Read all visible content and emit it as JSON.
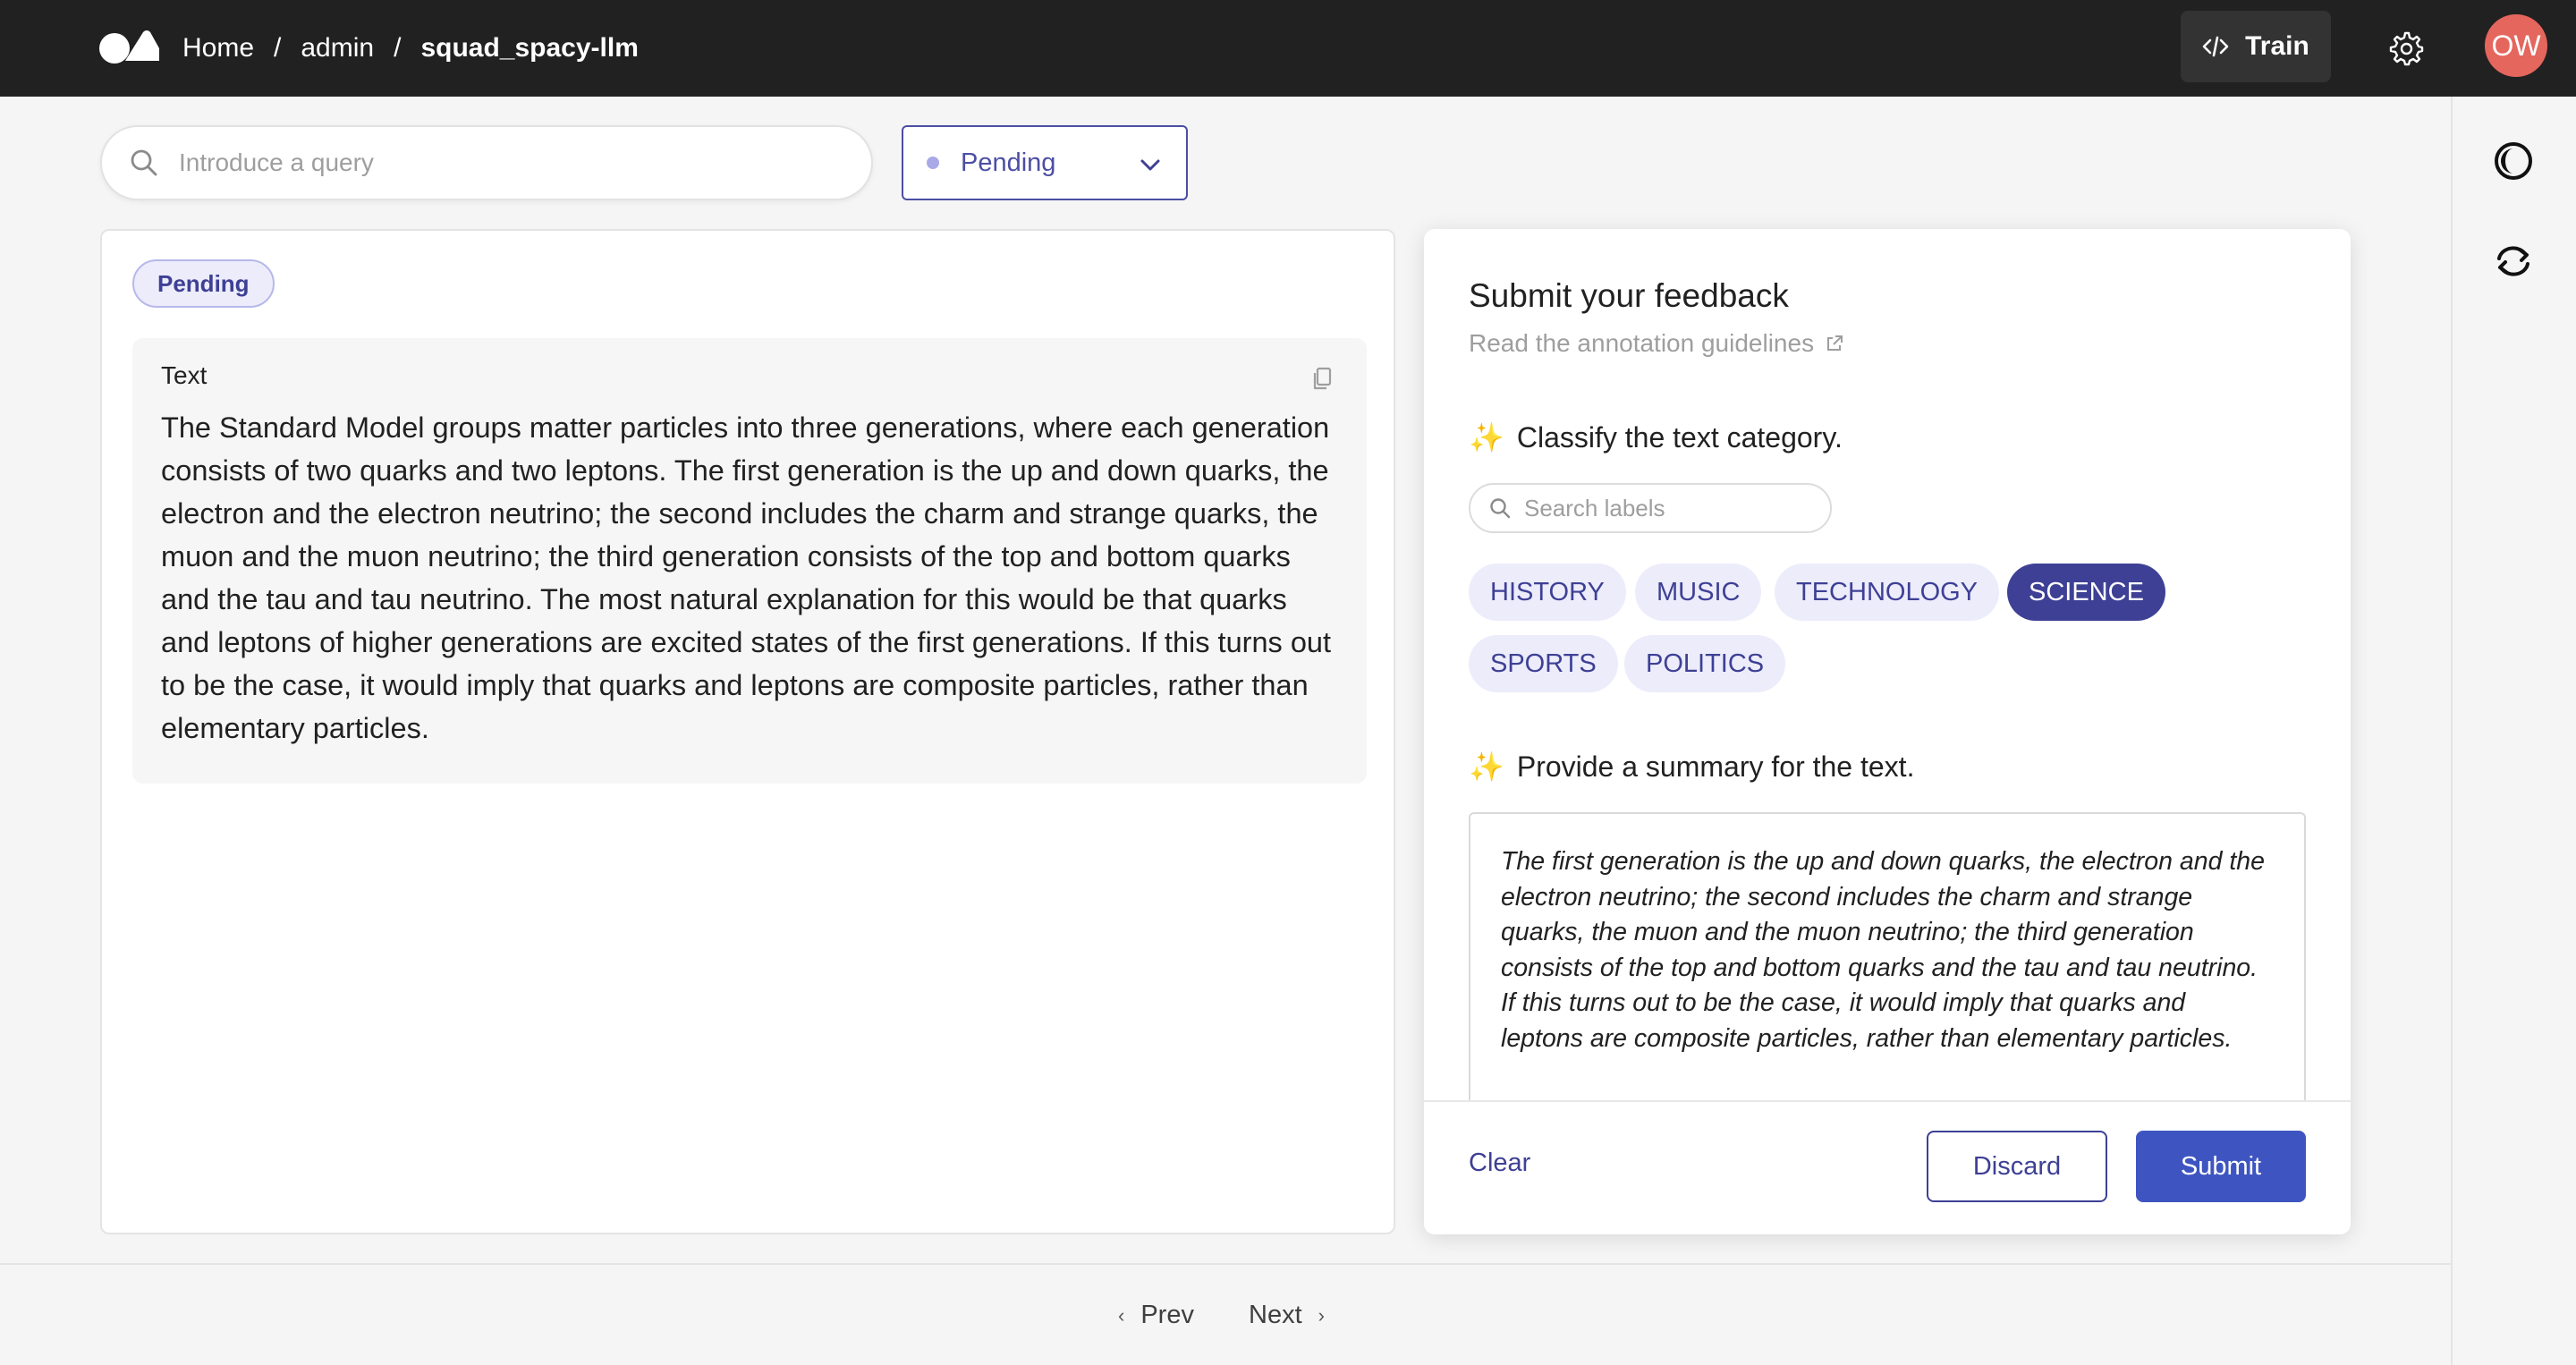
{
  "breadcrumb": {
    "home": "Home",
    "workspace": "admin",
    "dataset": "squad_spacy-llm",
    "separator": "/"
  },
  "header": {
    "train_label": "Train",
    "avatar_initials": "OW",
    "avatar_color": "#e5665d"
  },
  "filters": {
    "search_placeholder": "Introduce a query",
    "search_value": "",
    "status_selected": "Pending"
  },
  "record": {
    "status_badge": "Pending",
    "field_title": "Text",
    "field_text": "The Standard Model groups matter particles into three generations, where each generation consists of two quarks and two leptons. The first generation is the up and down quarks, the electron and the electron neutrino; the second includes the charm and strange quarks, the muon and the muon neutrino; the third generation consists of the top and bottom quarks and the tau and tau neutrino. The most natural explanation for this would be that quarks and leptons of higher generations are excited states of the first generations. If this turns out to be the case, it would imply that quarks and leptons are composite particles, rather than elementary particles."
  },
  "feedback": {
    "title": "Submit your feedback",
    "guidelines_link": "Read the annotation guidelines",
    "question1": {
      "icon": "✨",
      "title": "Classify the text category.",
      "search_placeholder": "Search labels",
      "labels": [
        "HISTORY",
        "MUSIC",
        "TECHNOLOGY",
        "SCIENCE",
        "SPORTS",
        "POLITICS"
      ],
      "selected": "SCIENCE"
    },
    "question2": {
      "icon": "✨",
      "title": "Provide a summary for the text.",
      "value": "The first generation is the up and down quarks, the electron and the electron neutrino; the second includes the charm and strange quarks, the muon and the muon neutrino; the third generation consists of the top and bottom quarks and the tau and tau neutrino. If this turns out to be the case, it would imply that quarks and leptons are composite particles, rather than elementary particles."
    },
    "clear_label": "Clear",
    "discard_label": "Discard",
    "submit_label": "Submit"
  },
  "pagination": {
    "prev_label": "Prev",
    "next_label": "Next"
  },
  "colors": {
    "topbar": "#212121",
    "accent": "#3e4095",
    "submit": "#3e55c1"
  },
  "icons": [
    "logo-icon",
    "code-icon",
    "gear-icon",
    "search-icon",
    "chevron-down-icon",
    "copy-icon",
    "external-link-icon",
    "theme-toggle-icon",
    "refresh-icon",
    "chevron-left-icon",
    "chevron-right-icon"
  ]
}
